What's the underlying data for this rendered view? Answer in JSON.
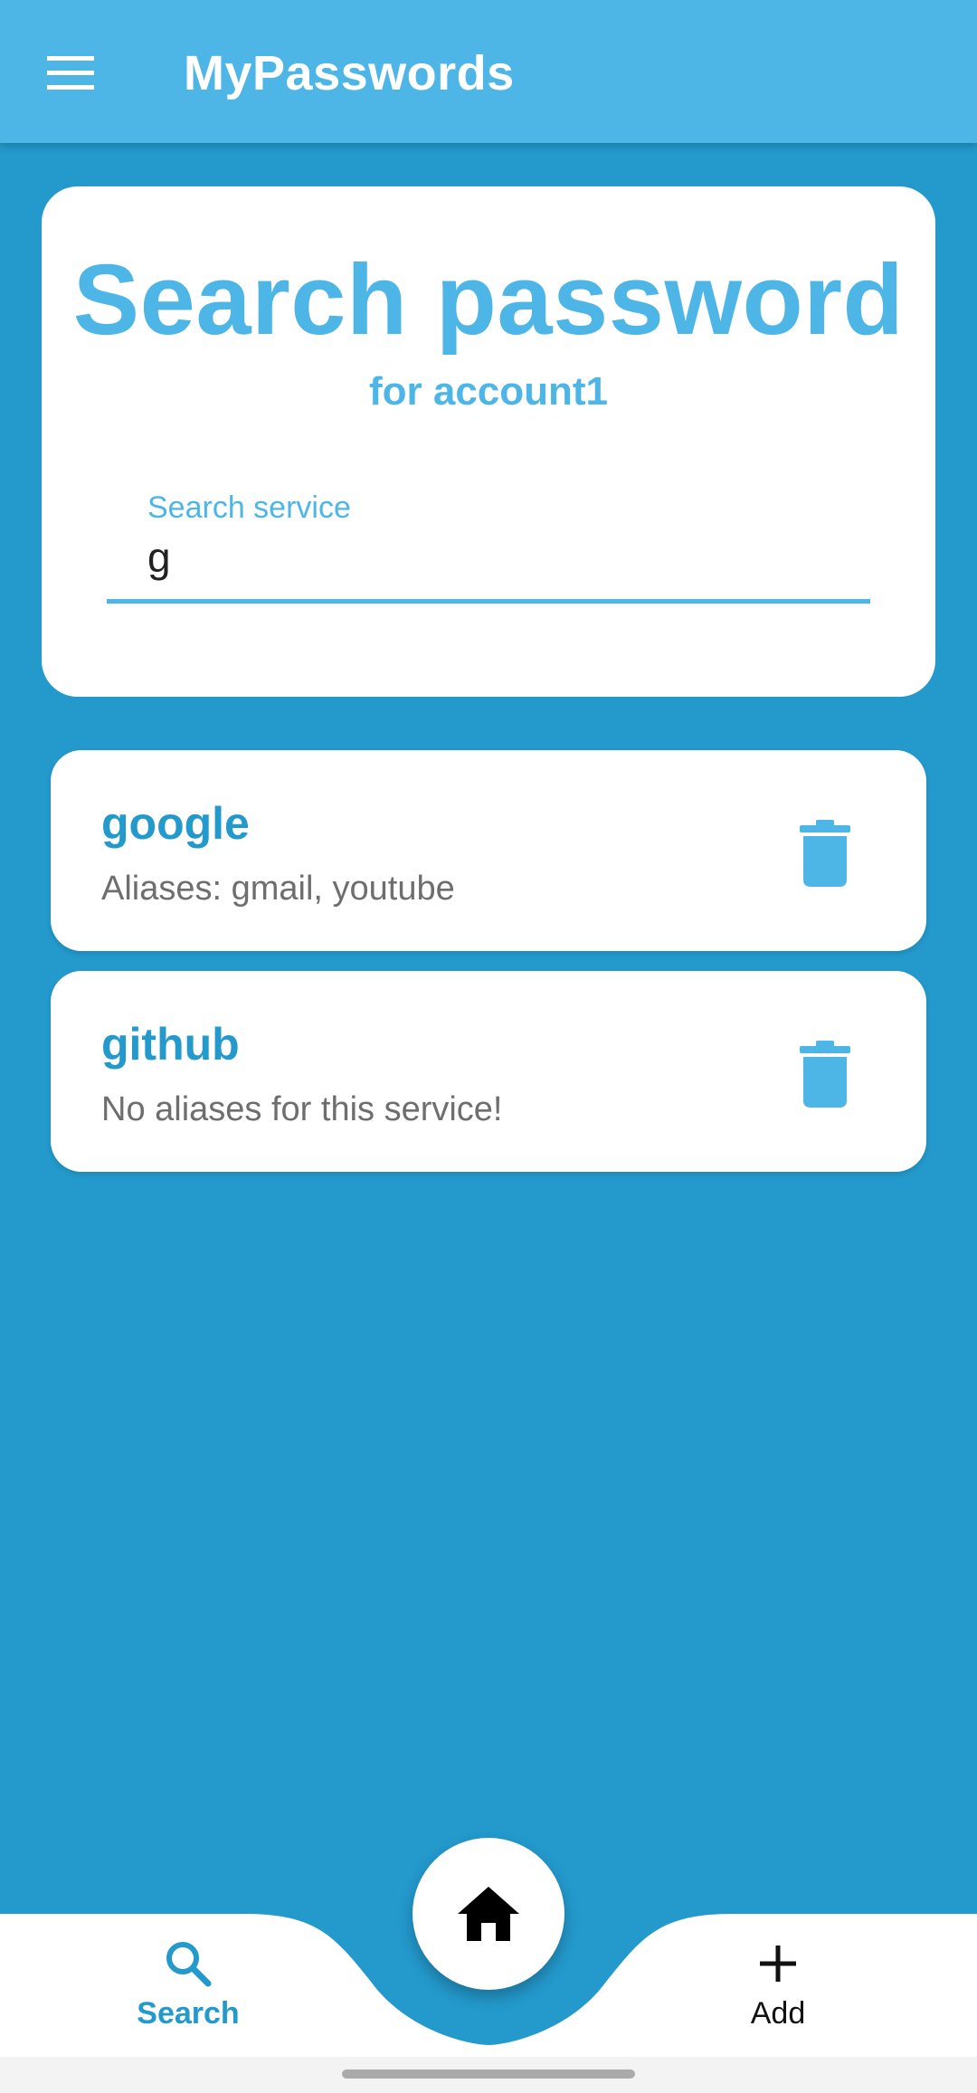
{
  "app": {
    "title": "MyPasswords",
    "menu_icon": "hamburger-menu-icon",
    "colors": {
      "primary": "#4db6e6",
      "background": "#2399cc",
      "surface": "#ffffff"
    }
  },
  "search": {
    "title": "Search password",
    "subtitle": "for account1",
    "field_label": "Search service",
    "field_value": "g"
  },
  "results": [
    {
      "name": "google",
      "aliases": "Aliases: gmail, youtube",
      "action_icon": "trash-icon"
    },
    {
      "name": "github",
      "aliases": "No aliases for this service!",
      "action_icon": "trash-icon"
    }
  ],
  "bottom_nav": {
    "search_label": "Search",
    "search_icon": "search-icon",
    "home_icon": "home-icon",
    "add_label": "Add",
    "add_icon": "plus-icon",
    "selected": "Search"
  }
}
